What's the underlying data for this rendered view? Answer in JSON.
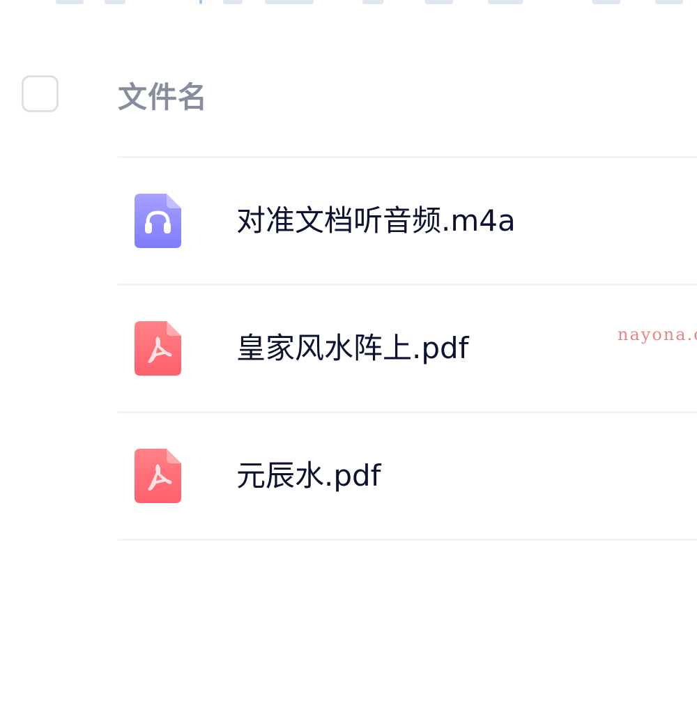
{
  "file_list": {
    "header": {
      "name_label": "文件名"
    },
    "files": [
      {
        "name": "对准文档听音频.m4a",
        "icon": "audio-file-icon",
        "icon_color": "#8d8bff"
      },
      {
        "name": "皇家风水阵上.pdf",
        "icon": "pdf-file-icon",
        "icon_color": "#ff6b74"
      },
      {
        "name": "元辰水.pdf",
        "icon": "pdf-file-icon",
        "icon_color": "#ff6b74"
      }
    ]
  },
  "watermark": {
    "text": "nayona.c"
  },
  "colors": {
    "header_text": "#878d9c",
    "row_text": "#0c1230",
    "divider": "#f2f3f6",
    "checkbox_border": "#dcdfe6",
    "watermark": "#e58787"
  }
}
